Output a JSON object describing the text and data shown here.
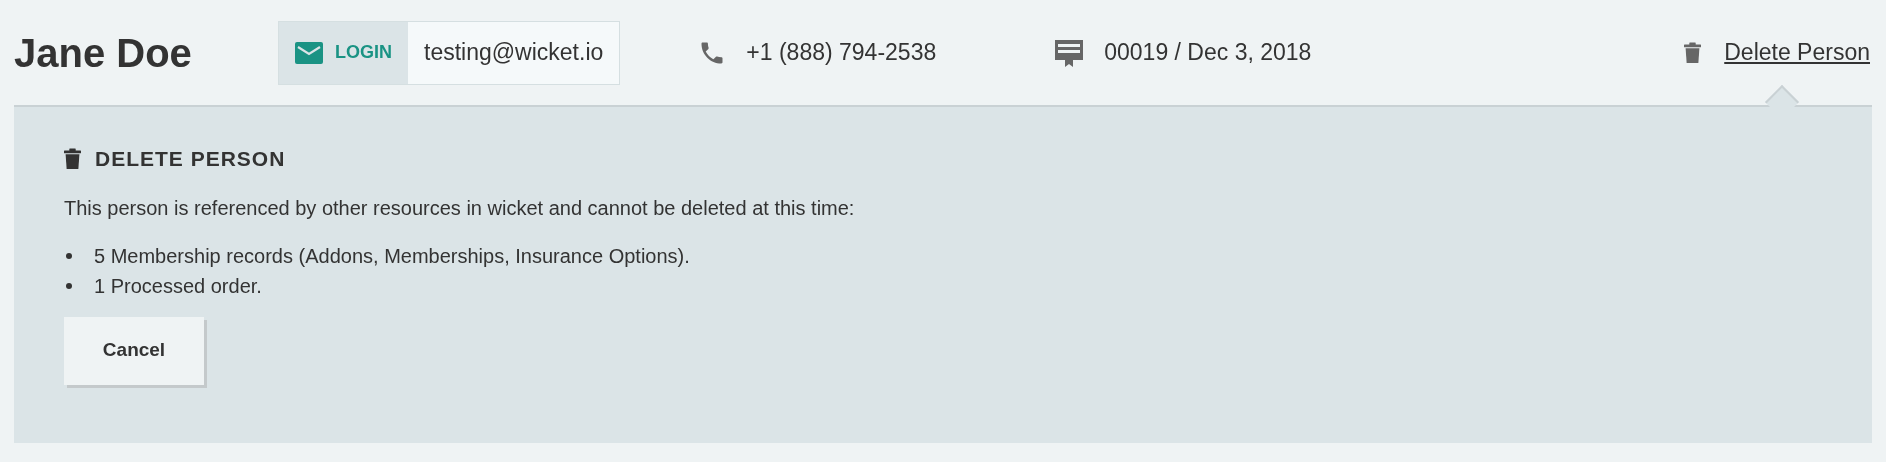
{
  "person": {
    "name": "Jane Doe"
  },
  "login": {
    "label": "LOGIN",
    "email": "testing@wicket.io"
  },
  "phone": "+1 (888) 794-2538",
  "membership": "00019 / Dec 3, 2018",
  "delete_link": "Delete Person",
  "panel": {
    "title": "DELETE PERSON",
    "message": "This person is referenced by other resources in wicket and cannot be deleted at this time:",
    "items": [
      "5 Membership records (Addons, Memberships, Insurance Options).",
      "1 Processed order."
    ],
    "cancel": "Cancel"
  }
}
